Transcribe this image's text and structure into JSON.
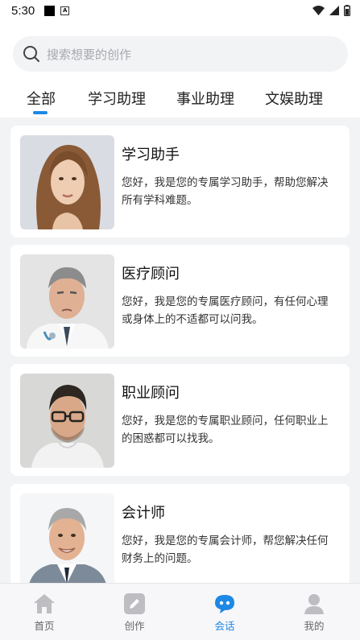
{
  "status_bar": {
    "time": "5:30"
  },
  "search": {
    "placeholder": "搜索想要的创作"
  },
  "tabs": [
    {
      "label": "全部"
    },
    {
      "label": "学习助理"
    },
    {
      "label": "事业助理"
    },
    {
      "label": "文娱助理"
    }
  ],
  "assistants": [
    {
      "title": "学习助手",
      "description": "您好，我是您的专属学习助手，帮助您解决所有学科难题。"
    },
    {
      "title": "医疗顾问",
      "description": "您好，我是您的专属医疗顾问，有任何心理或身体上的不适都可以问我。"
    },
    {
      "title": "职业顾问",
      "description": "您好，我是您的专属职业顾问，任何职业上的困惑都可以找我。"
    },
    {
      "title": "会计师",
      "description": "您好，我是您的专属会计师，帮您解决任何财务上的问题。"
    }
  ],
  "bottom_nav": [
    {
      "label": "首页",
      "icon": "home-icon"
    },
    {
      "label": "创作",
      "icon": "edit-icon"
    },
    {
      "label": "会话",
      "icon": "chat-icon"
    },
    {
      "label": "我的",
      "icon": "user-icon"
    }
  ],
  "colors": {
    "accent": "#1e88e5",
    "nav_inactive": "#bdbdc2"
  }
}
